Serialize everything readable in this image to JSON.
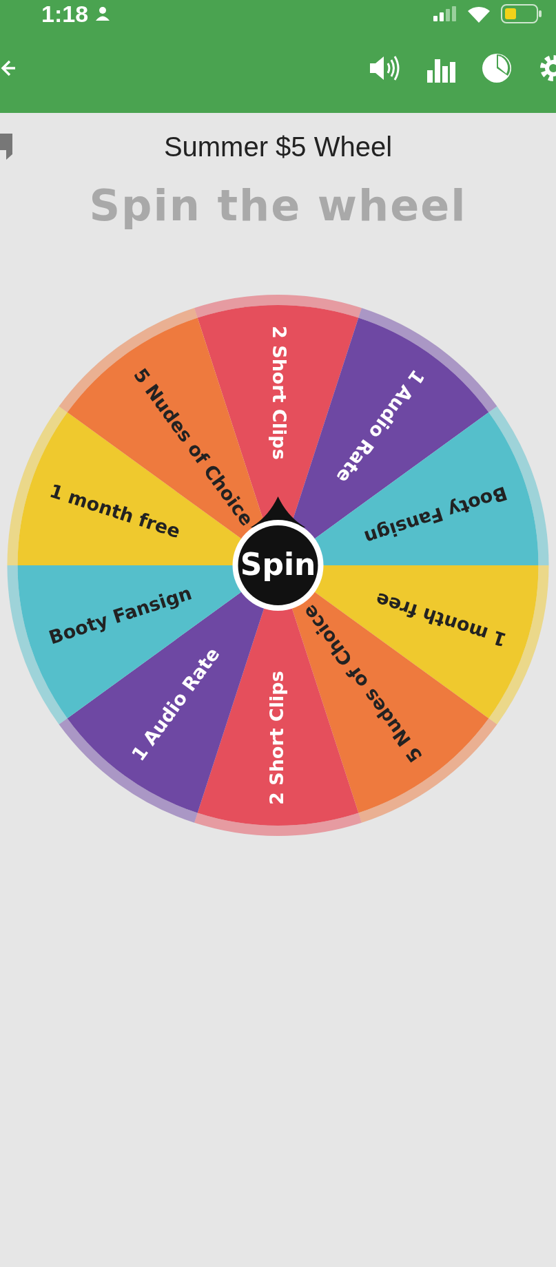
{
  "status_bar": {
    "time": "1:18"
  },
  "title": "Summer $5 Wheel",
  "heading": "Spin the wheel",
  "wheel": {
    "button": "Spin",
    "segments": [
      {
        "label": "2 Short Clips",
        "color": "#e54f5c"
      },
      {
        "label": "1 Audio Rate",
        "color": "#6e48a3"
      },
      {
        "label": "Booty Fansign",
        "color": "#55bfcb"
      },
      {
        "label": "1 month free",
        "color": "#efc92e"
      },
      {
        "label": "5 Nudes of Choice",
        "color": "#ee7a3e"
      },
      {
        "label": "2 Short Clips",
        "color": "#e54f5c"
      },
      {
        "label": "1 Audio Rate",
        "color": "#6e48a3"
      },
      {
        "label": "Booty Fansign",
        "color": "#55bfcb"
      },
      {
        "label": "1 month free",
        "color": "#efc92e"
      },
      {
        "label": "5 Nudes of Choice",
        "color": "#ee7a3e"
      }
    ]
  }
}
